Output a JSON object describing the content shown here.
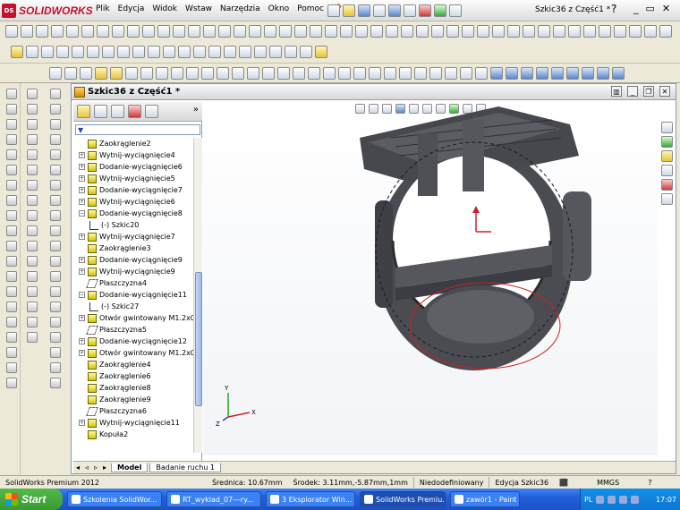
{
  "app": {
    "name": "SOLIDWORKS",
    "logo_text": "DS"
  },
  "menu": {
    "items": [
      "Plik",
      "Edycja",
      "Widok",
      "Wstaw",
      "Narzędzia",
      "Okno",
      "Pomoc"
    ]
  },
  "titlebar": {
    "doc_title": "Szkic36 z Część1 *",
    "help": "?"
  },
  "document": {
    "title": "Szkic36 z Część1 *"
  },
  "tree": {
    "nodes": [
      {
        "label": "Zaokrąglenie2",
        "expand": ""
      },
      {
        "label": "Wytnij-wyciągnięcie4",
        "expand": "+"
      },
      {
        "label": "Dodanie-wyciągnięcie6",
        "expand": "+"
      },
      {
        "label": "Wytnij-wyciągnięcie5",
        "expand": "+"
      },
      {
        "label": "Dodanie-wyciągnięcie7",
        "expand": "+"
      },
      {
        "label": "Wytnij-wyciągnięcie6",
        "expand": "+"
      },
      {
        "label": "Dodanie-wyciągnięcie8",
        "expand": "−"
      },
      {
        "label": "(-) Szkic20",
        "expand": "",
        "sub": true
      },
      {
        "label": "Wytnij-wyciągnięcie7",
        "expand": "+"
      },
      {
        "label": "Zaokrąglenie3",
        "expand": ""
      },
      {
        "label": "Dodanie-wyciągnięcie9",
        "expand": "+"
      },
      {
        "label": "Wytnij-wyciągnięcie9",
        "expand": "+"
      },
      {
        "label": "Płaszczyzna4",
        "expand": ""
      },
      {
        "label": "Dodanie-wyciągnięcie11",
        "expand": "−"
      },
      {
        "label": "(-) Szkic27",
        "expand": "",
        "sub": true
      },
      {
        "label": "Otwór gwintowany M1.2x0.",
        "expand": "+"
      },
      {
        "label": "Płaszczyzna5",
        "expand": ""
      },
      {
        "label": "Dodanie-wyciągnięcie12",
        "expand": "+"
      },
      {
        "label": "Otwór gwintowany M1.2x0.",
        "expand": "+"
      },
      {
        "label": "Zaokrąglenie4",
        "expand": ""
      },
      {
        "label": "Zaokrąglenie6",
        "expand": ""
      },
      {
        "label": "Zaokrąglenie8",
        "expand": ""
      },
      {
        "label": "Zaokrąglenie9",
        "expand": ""
      },
      {
        "label": "Płaszczyzna6",
        "expand": ""
      },
      {
        "label": "Wytnij-wyciągnięcie11",
        "expand": "+"
      },
      {
        "label": "Kopuła2",
        "expand": ""
      }
    ]
  },
  "doc_tabs": {
    "model": "Model",
    "motion": "Badanie ruchu 1"
  },
  "triad": {
    "x": "X",
    "y": "Y",
    "z": "Z"
  },
  "status": {
    "product": "SolidWorks Premium 2012",
    "diameter": "Średnica: 10.67mm",
    "center": "Środek: 3.11mm,-5.87mm,1mm",
    "state": "Niedodefiniowany",
    "edit": "Edycja Szkic36",
    "units": "MMGS",
    "help": "?"
  },
  "taskbar": {
    "start": "Start",
    "tasks": [
      {
        "label": "Szkolenia SolidWor...",
        "active": false
      },
      {
        "label": "RT_wyklad_07---ry...",
        "active": false
      },
      {
        "label": "3 Eksplorator Win...",
        "active": false
      },
      {
        "label": "SolidWorks Premiu...",
        "active": true
      },
      {
        "label": "zawór1 - Paint",
        "active": false
      }
    ],
    "lang": "PL",
    "clock": "17:07"
  },
  "colors": {
    "accent": "#c8102e",
    "model": "#4a4c52",
    "sketch_circle": "#cc2222",
    "taskbar": "#245edb"
  }
}
